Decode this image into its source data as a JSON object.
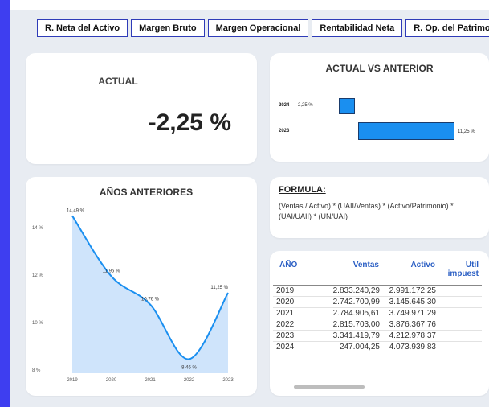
{
  "tabs": [
    "R. Neta del Activo",
    "Margen Bruto",
    "Margen Operacional",
    "Rentabilidad Neta",
    "R. Op. del Patrimonio"
  ],
  "actual": {
    "label": "ACTUAL",
    "value": "-2,25 %"
  },
  "vs": {
    "title": "ACTUAL VS ANTERIOR",
    "rows": [
      {
        "year": "2024",
        "label": "-2,25 %"
      },
      {
        "year": "2023",
        "label": "11,25 %"
      }
    ]
  },
  "previous": {
    "title": "AÑOS ANTERIORES"
  },
  "formula": {
    "title": "FORMULA:",
    "text": "(Ventas / Activo) * (UAII/Ventas) * (Activo/Patrimonio) * (UAI/UAII) * (UN/UAI)"
  },
  "table": {
    "headers": {
      "year": "AÑO",
      "ventas": "Ventas",
      "activo": "Activo",
      "util": "Util impuest"
    },
    "rows": [
      {
        "year": "2019",
        "ventas": "2.833.240,29",
        "activo": "2.991.172,25"
      },
      {
        "year": "2020",
        "ventas": "2.742.700,99",
        "activo": "3.145.645,30"
      },
      {
        "year": "2021",
        "ventas": "2.784.905,61",
        "activo": "3.749.971,29"
      },
      {
        "year": "2022",
        "ventas": "2.815.703,00",
        "activo": "3.876.367,76"
      },
      {
        "year": "2023",
        "ventas": "3.341.419,79",
        "activo": "4.212.978,37"
      },
      {
        "year": "2024",
        "ventas": "247.004,25",
        "activo": "4.073.939,83"
      }
    ]
  },
  "chart_data": {
    "type": "area",
    "x": [
      "2019",
      "2020",
      "2021",
      "2022",
      "2023"
    ],
    "values": [
      14.49,
      11.95,
      10.76,
      8.46,
      11.25
    ],
    "labels": [
      "14,49 %",
      "11,95 %",
      "10,76 %",
      "8,46 %",
      "11,25 %"
    ],
    "yticks": [
      "8 %",
      "10 %",
      "12 %",
      "14 %"
    ],
    "ylim": [
      8,
      14.5
    ],
    "fill": "#cfe4fb",
    "line": "#1a8ff0"
  }
}
